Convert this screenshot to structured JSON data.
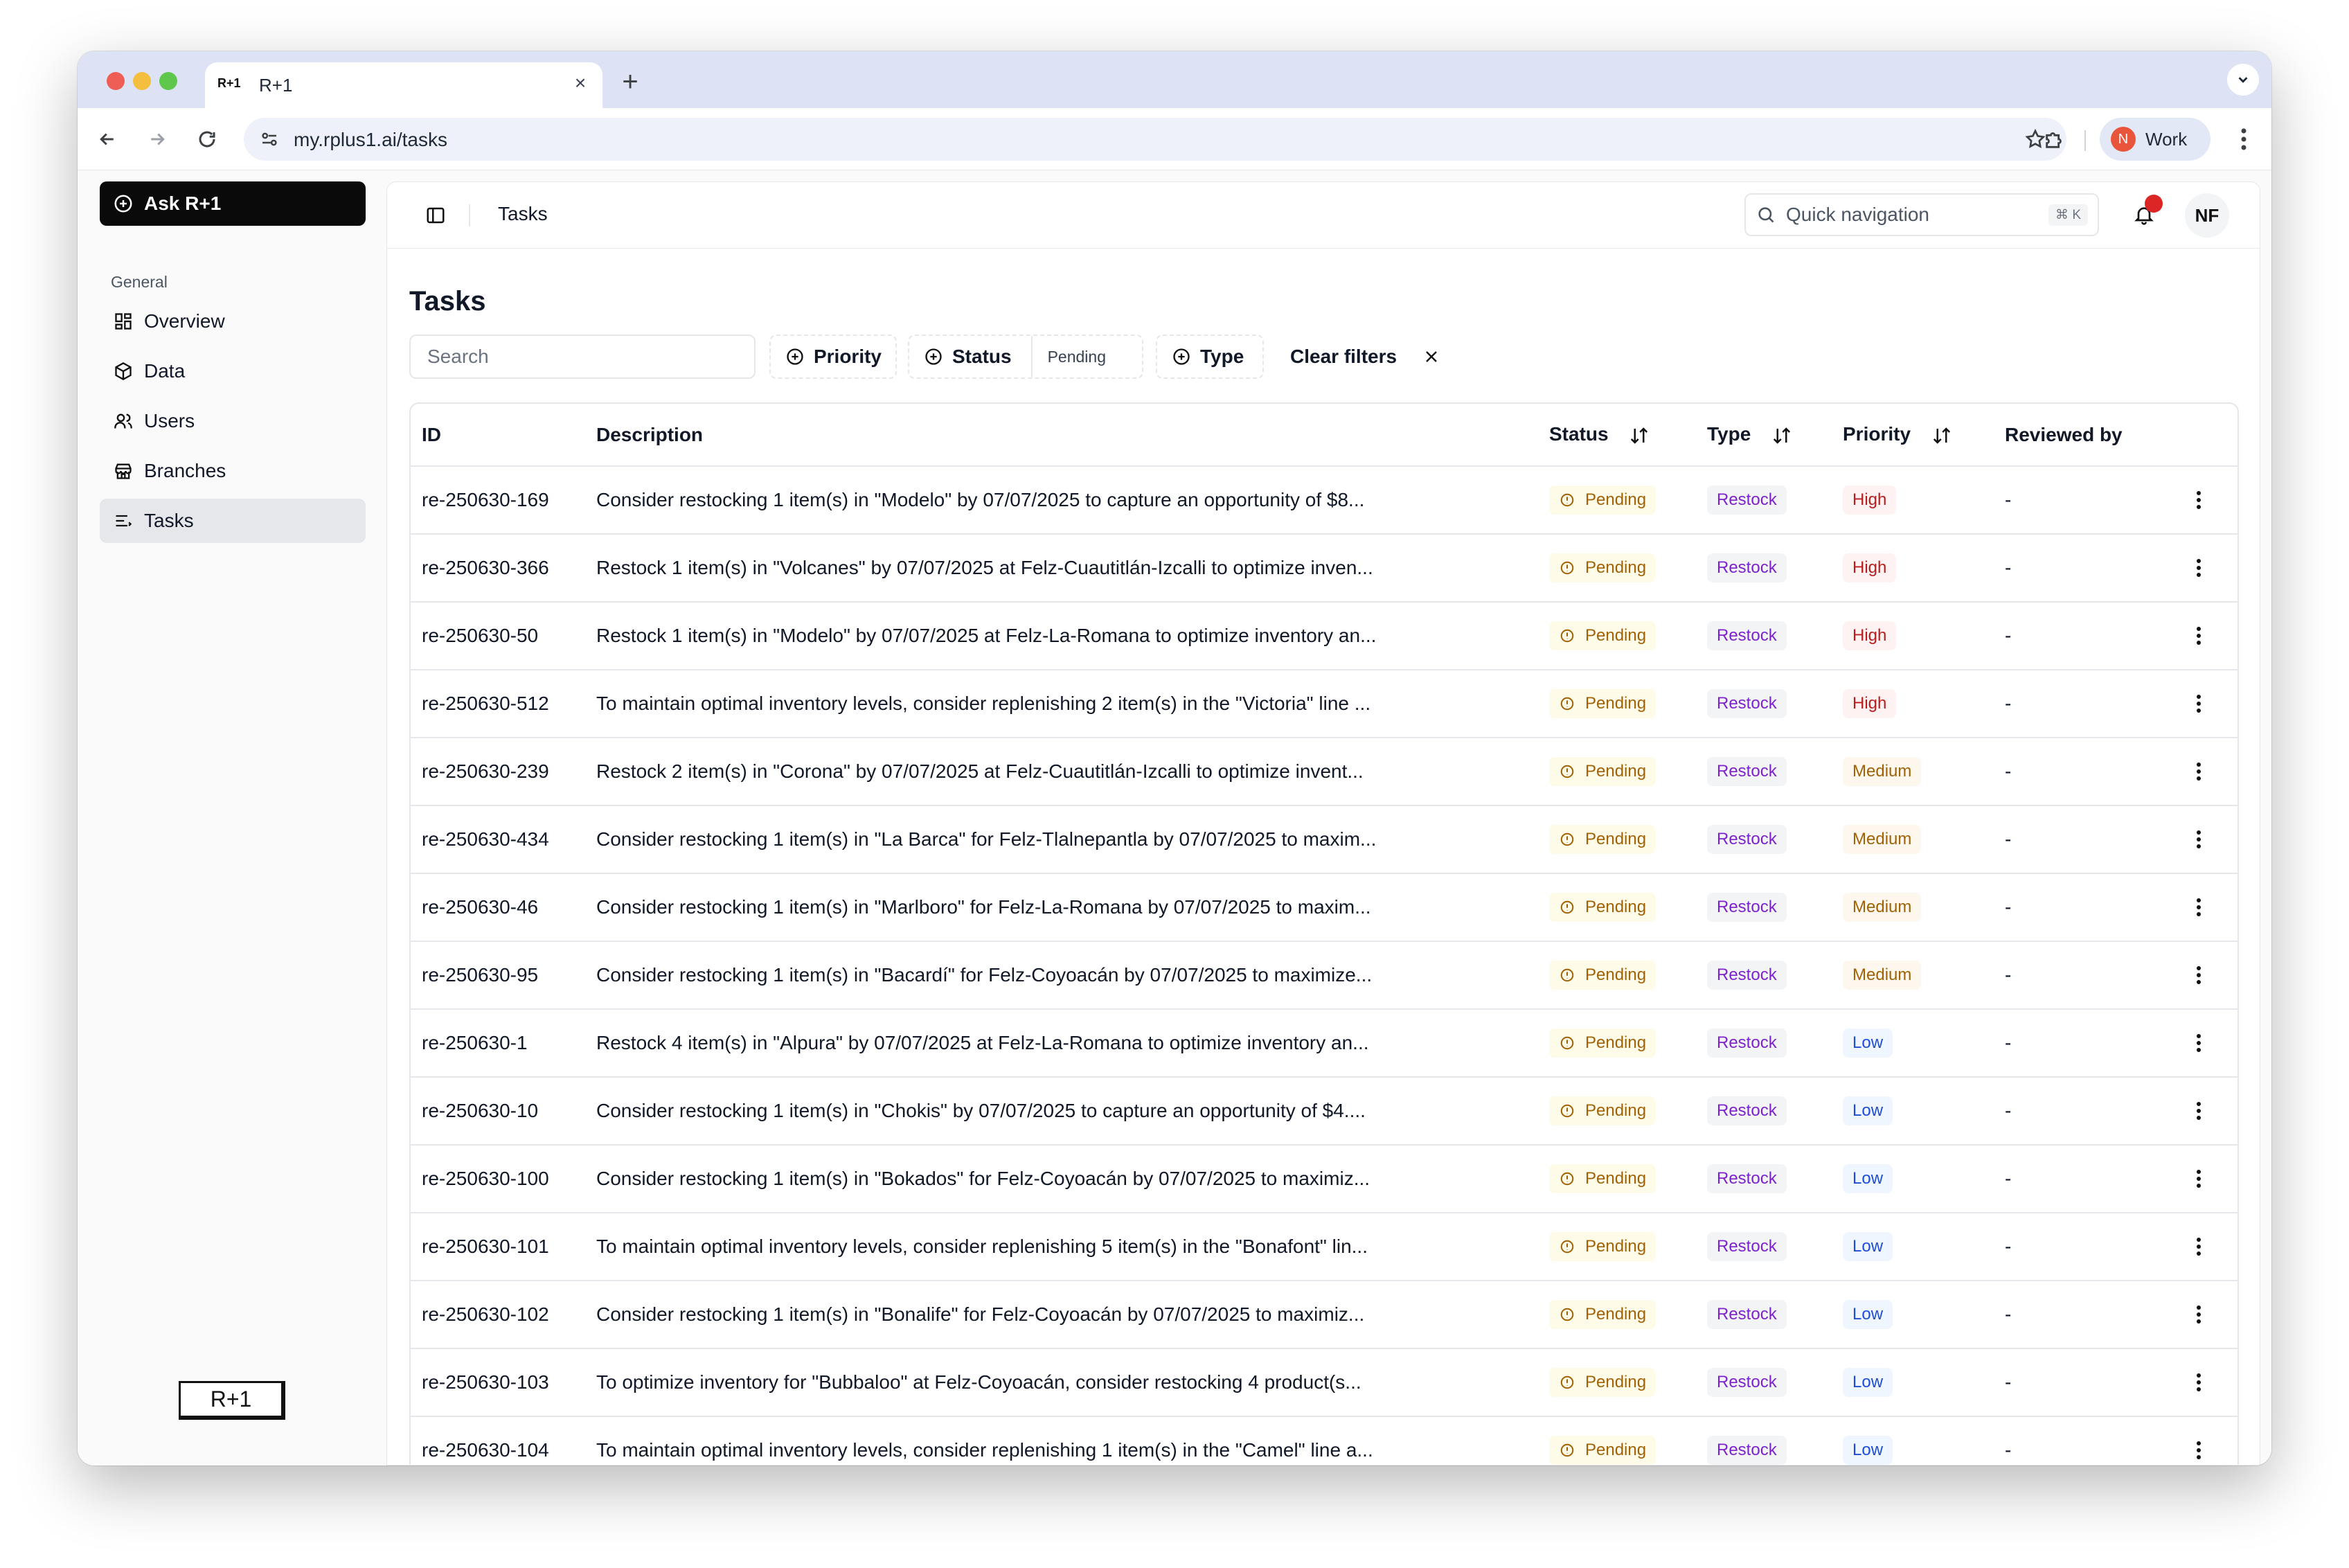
{
  "browser": {
    "tab_favicon": "R+1",
    "tab_title": "R+1",
    "url": "my.rplus1.ai/tasks",
    "profile_initial": "N",
    "profile_label": "Work"
  },
  "sidebar": {
    "ask_label": "Ask R+1",
    "section_label": "General",
    "items": [
      {
        "label": "Overview",
        "icon": "dashboard-icon"
      },
      {
        "label": "Data",
        "icon": "package-icon"
      },
      {
        "label": "Users",
        "icon": "users-icon"
      },
      {
        "label": "Branches",
        "icon": "store-icon"
      },
      {
        "label": "Tasks",
        "icon": "list-icon",
        "active": true
      }
    ],
    "logo_text": "R+1"
  },
  "header": {
    "breadcrumb": "Tasks",
    "quicknav_placeholder": "Quick navigation",
    "quicknav_shortcut": "⌘ K",
    "user_initials": "NF"
  },
  "page": {
    "title": "Tasks",
    "search_placeholder": "Search",
    "filters": {
      "priority_label": "Priority",
      "status_label": "Status",
      "status_value": "Pending",
      "type_label": "Type",
      "clear_label": "Clear filters"
    }
  },
  "table": {
    "columns": {
      "id": "ID",
      "description": "Description",
      "status": "Status",
      "type": "Type",
      "priority": "Priority",
      "reviewed_by": "Reviewed by"
    },
    "rows": [
      {
        "id": "re-250630-169",
        "description": "Consider restocking 1 item(s) in \"Modelo\" by 07/07/2025 to capture an opportunity of $8...",
        "status": "Pending",
        "type": "Restock",
        "priority": "High",
        "reviewed_by": "-"
      },
      {
        "id": "re-250630-366",
        "description": "Restock 1 item(s) in \"Volcanes\" by 07/07/2025 at Felz-Cuautitlán-Izcalli to optimize inven...",
        "status": "Pending",
        "type": "Restock",
        "priority": "High",
        "reviewed_by": "-"
      },
      {
        "id": "re-250630-50",
        "description": "Restock 1 item(s) in \"Modelo\" by 07/07/2025 at Felz-La-Romana to optimize inventory an...",
        "status": "Pending",
        "type": "Restock",
        "priority": "High",
        "reviewed_by": "-"
      },
      {
        "id": "re-250630-512",
        "description": "To maintain optimal inventory levels, consider replenishing 2 item(s) in the \"Victoria\" line ...",
        "status": "Pending",
        "type": "Restock",
        "priority": "High",
        "reviewed_by": "-"
      },
      {
        "id": "re-250630-239",
        "description": "Restock 2 item(s) in \"Corona\" by 07/07/2025 at Felz-Cuautitlán-Izcalli to optimize invent...",
        "status": "Pending",
        "type": "Restock",
        "priority": "Medium",
        "reviewed_by": "-"
      },
      {
        "id": "re-250630-434",
        "description": "Consider restocking 1 item(s) in \"La Barca\" for Felz-Tlalnepantla by 07/07/2025 to maxim...",
        "status": "Pending",
        "type": "Restock",
        "priority": "Medium",
        "reviewed_by": "-"
      },
      {
        "id": "re-250630-46",
        "description": "Consider restocking 1 item(s) in \"Marlboro\" for Felz-La-Romana by 07/07/2025 to maxim...",
        "status": "Pending",
        "type": "Restock",
        "priority": "Medium",
        "reviewed_by": "-"
      },
      {
        "id": "re-250630-95",
        "description": "Consider restocking 1 item(s) in \"Bacardí\" for Felz-Coyoacán by 07/07/2025 to maximize...",
        "status": "Pending",
        "type": "Restock",
        "priority": "Medium",
        "reviewed_by": "-"
      },
      {
        "id": "re-250630-1",
        "description": "Restock 4 item(s) in \"Alpura\" by 07/07/2025 at Felz-La-Romana to optimize inventory an...",
        "status": "Pending",
        "type": "Restock",
        "priority": "Low",
        "reviewed_by": "-"
      },
      {
        "id": "re-250630-10",
        "description": "Consider restocking 1 item(s) in \"Chokis\" by 07/07/2025 to capture an opportunity of $4....",
        "status": "Pending",
        "type": "Restock",
        "priority": "Low",
        "reviewed_by": "-"
      },
      {
        "id": "re-250630-100",
        "description": "Consider restocking 1 item(s) in \"Bokados\" for Felz-Coyoacán by 07/07/2025 to maximiz...",
        "status": "Pending",
        "type": "Restock",
        "priority": "Low",
        "reviewed_by": "-"
      },
      {
        "id": "re-250630-101",
        "description": "To maintain optimal inventory levels, consider replenishing 5 item(s) in the \"Bonafont\" lin...",
        "status": "Pending",
        "type": "Restock",
        "priority": "Low",
        "reviewed_by": "-"
      },
      {
        "id": "re-250630-102",
        "description": "Consider restocking 1 item(s) in \"Bonalife\" for Felz-Coyoacán by 07/07/2025 to maximiz...",
        "status": "Pending",
        "type": "Restock",
        "priority": "Low",
        "reviewed_by": "-"
      },
      {
        "id": "re-250630-103",
        "description": "To optimize inventory for \"Bubbaloo\" at Felz-Coyoacán, consider restocking 4 product(s...",
        "status": "Pending",
        "type": "Restock",
        "priority": "Low",
        "reviewed_by": "-"
      },
      {
        "id": "re-250630-104",
        "description": "To maintain optimal inventory levels, consider replenishing 1 item(s) in the \"Camel\" line a...",
        "status": "Pending",
        "type": "Restock",
        "priority": "Low",
        "reviewed_by": "-"
      }
    ]
  },
  "colors": {
    "pending_bg": "#fefce8",
    "pending_text": "#a16207",
    "restock_text": "#7e22ce",
    "high_text": "#b91c1c",
    "medium_text": "#a16207",
    "low_text": "#1d4ed8"
  }
}
